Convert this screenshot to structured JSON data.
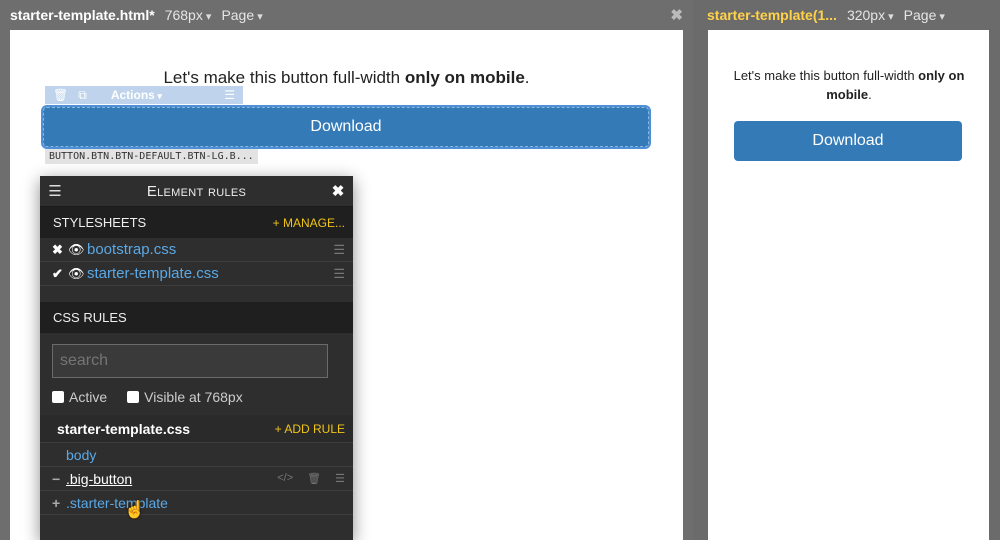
{
  "left": {
    "tab_title": "starter-template.html*",
    "viewport": "768px",
    "page_menu": "Page",
    "close": "✖",
    "lead_text": "Let's make this button full-width ",
    "lead_bold": "only on mobile",
    "lead_end": ".",
    "selection_toolbar": {
      "delete_icon": "🗑",
      "copy_icon": "⧉",
      "actions_label": "Actions",
      "menu_icon": "☰"
    },
    "download_label": "Download",
    "selector_path": "BUTTON.BTN.BTN-DEFAULT.BTN-LG.B..."
  },
  "right": {
    "tab_title": "starter-template(1...",
    "viewport": "320px",
    "page_menu": "Page",
    "lead_text": "Let's make this button full-width ",
    "lead_bold": "only on mobile",
    "lead_end": ".",
    "download_label": "Download"
  },
  "panel": {
    "title": "Element rules",
    "menu_icon": "☰",
    "close_icon": "✖",
    "stylesheets_label": "STYLESHEETS",
    "manage_label": "+ MANAGE...",
    "stylesheets": [
      {
        "mark": "✖",
        "eye": "👁",
        "name": "bootstrap.css",
        "grip": "☰"
      },
      {
        "mark": "✔",
        "eye": "👁",
        "name": "starter-template.css",
        "grip": "☰"
      }
    ],
    "css_rules_label": "CSS RULES",
    "search_placeholder": "search",
    "check_active": "Active",
    "check_visible": "Visible at 768px",
    "file_name": "starter-template.css",
    "add_rule_label": "+ ADD RULE",
    "rules": [
      {
        "prefix": "",
        "name": "body"
      },
      {
        "prefix": "−",
        "name": ".big-button"
      },
      {
        "prefix": "+",
        "name": ".starter-template"
      }
    ],
    "rule_tools": {
      "code_icon": "</>",
      "trash_icon": "🗑",
      "grip_icon": "☰"
    }
  },
  "colors": {
    "accent_blue": "#337ab7",
    "link_blue": "#5aa9e6",
    "yellow": "#f0c419"
  }
}
